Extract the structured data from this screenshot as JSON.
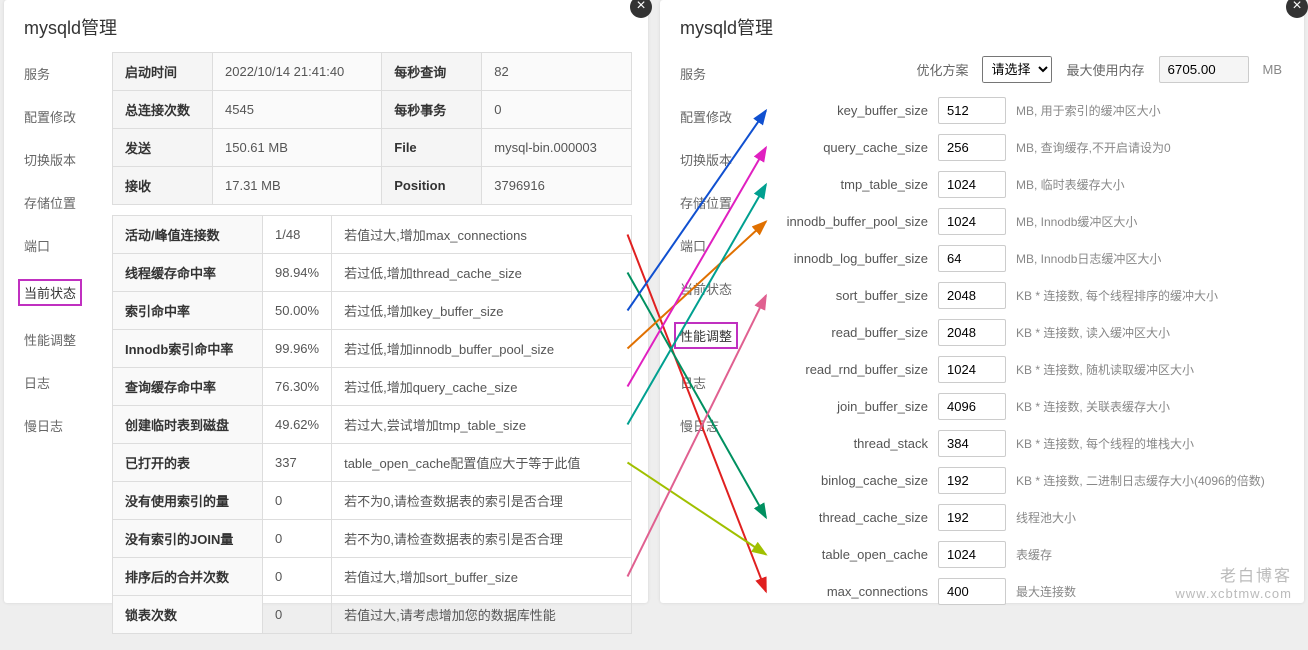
{
  "left_panel": {
    "title": "mysqld管理",
    "nav": [
      "服务",
      "配置修改",
      "切换版本",
      "存储位置",
      "端口",
      "当前状态",
      "性能调整",
      "日志",
      "慢日志"
    ],
    "active_nav": "当前状态",
    "stats": {
      "r1": {
        "k1": "启动时间",
        "v1": "2022/10/14 21:41:40",
        "k2": "每秒查询",
        "v2": "82"
      },
      "r2": {
        "k1": "总连接次数",
        "v1": "4545",
        "k2": "每秒事务",
        "v2": "0"
      },
      "r3": {
        "k1": "发送",
        "v1": "150.61 MB",
        "k2": "File",
        "v2": "mysql-bin.000003"
      },
      "r4": {
        "k1": "接收",
        "v1": "17.31 MB",
        "k2": "Position",
        "v2": "3796916"
      }
    },
    "status": [
      {
        "name": "活动/峰值连接数",
        "val": "1/48",
        "advice": "若值过大,增加max_connections"
      },
      {
        "name": "线程缓存命中率",
        "val": "98.94%",
        "advice": "若过低,增加thread_cache_size"
      },
      {
        "name": "索引命中率",
        "val": "50.00%",
        "advice": "若过低,增加key_buffer_size"
      },
      {
        "name": "Innodb索引命中率",
        "val": "99.96%",
        "advice": "若过低,增加innodb_buffer_pool_size"
      },
      {
        "name": "查询缓存命中率",
        "val": "76.30%",
        "advice": "若过低,增加query_cache_size"
      },
      {
        "name": "创建临时表到磁盘",
        "val": "49.62%",
        "advice": "若过大,尝试增加tmp_table_size"
      },
      {
        "name": "已打开的表",
        "val": "337",
        "advice": "table_open_cache配置值应大于等于此值"
      },
      {
        "name": "没有使用索引的量",
        "val": "0",
        "advice": "若不为0,请检查数据表的索引是否合理"
      },
      {
        "name": "没有索引的JOIN量",
        "val": "0",
        "advice": "若不为0,请检查数据表的索引是否合理"
      },
      {
        "name": "排序后的合并次数",
        "val": "0",
        "advice": "若值过大,增加sort_buffer_size"
      },
      {
        "name": "锁表次数",
        "val": "0",
        "advice": "若值过大,请考虑增加您的数据库性能"
      }
    ]
  },
  "right_panel": {
    "title": "mysqld管理",
    "nav": [
      "服务",
      "配置修改",
      "切换版本",
      "存储位置",
      "端口",
      "当前状态",
      "性能调整",
      "日志",
      "慢日志"
    ],
    "active_nav": "性能调整",
    "topbar": {
      "plan_label": "优化方案",
      "plan_placeholder": "请选择",
      "mem_label": "最大使用内存",
      "mem_value": "6705.00",
      "mem_unit": "MB"
    },
    "params": [
      {
        "name": "key_buffer_size",
        "val": "512",
        "desc": "MB, 用于索引的缓冲区大小"
      },
      {
        "name": "query_cache_size",
        "val": "256",
        "desc": "MB, 查询缓存,不开启请设为0"
      },
      {
        "name": "tmp_table_size",
        "val": "1024",
        "desc": "MB, 临时表缓存大小"
      },
      {
        "name": "innodb_buffer_pool_size",
        "val": "1024",
        "desc": "MB, Innodb缓冲区大小"
      },
      {
        "name": "innodb_log_buffer_size",
        "val": "64",
        "desc": "MB, Innodb日志缓冲区大小"
      },
      {
        "name": "sort_buffer_size",
        "val": "2048",
        "desc": "KB * 连接数, 每个线程排序的缓冲大小"
      },
      {
        "name": "read_buffer_size",
        "val": "2048",
        "desc": "KB * 连接数, 读入缓冲区大小"
      },
      {
        "name": "read_rnd_buffer_size",
        "val": "1024",
        "desc": "KB * 连接数, 随机读取缓冲区大小"
      },
      {
        "name": "join_buffer_size",
        "val": "4096",
        "desc": "KB * 连接数, 关联表缓存大小"
      },
      {
        "name": "thread_stack",
        "val": "384",
        "desc": "KB * 连接数, 每个线程的堆栈大小"
      },
      {
        "name": "binlog_cache_size",
        "val": "192",
        "desc": "KB * 连接数, 二进制日志缓存大小(4096的倍数)"
      },
      {
        "name": "thread_cache_size",
        "val": "192",
        "desc": "线程池大小"
      },
      {
        "name": "table_open_cache",
        "val": "1024",
        "desc": "表缓存"
      },
      {
        "name": "max_connections",
        "val": "400",
        "desc": "最大连接数"
      }
    ]
  },
  "arrows": [
    {
      "from_idx": 0,
      "to_idx": 13,
      "color": "#e02020"
    },
    {
      "from_idx": 1,
      "to_idx": 11,
      "color": "#009060"
    },
    {
      "from_idx": 2,
      "to_idx": 0,
      "color": "#1050d0"
    },
    {
      "from_idx": 3,
      "to_idx": 3,
      "color": "#e07000"
    },
    {
      "from_idx": 4,
      "to_idx": 1,
      "color": "#e020c0"
    },
    {
      "from_idx": 5,
      "to_idx": 2,
      "color": "#00a090"
    },
    {
      "from_idx": 6,
      "to_idx": 12,
      "color": "#a0c000"
    },
    {
      "from_idx": 9,
      "to_idx": 5,
      "color": "#e06090"
    }
  ],
  "watermark": {
    "name": "老白博客",
    "url": "www.xcbtmw.com"
  }
}
